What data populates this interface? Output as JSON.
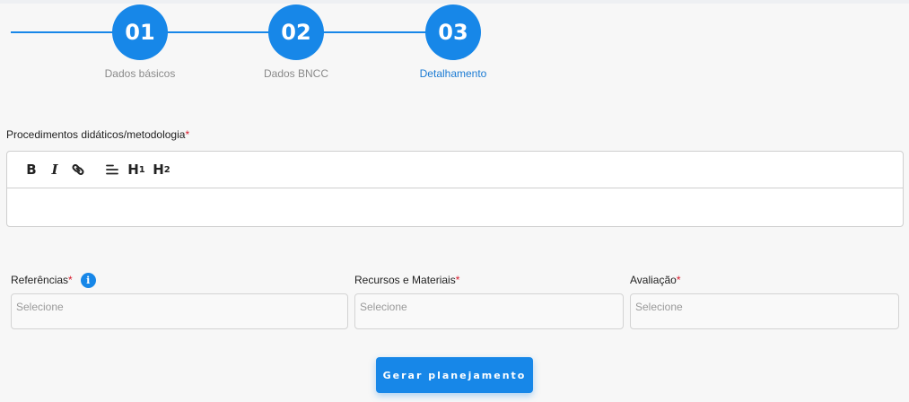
{
  "stepper": {
    "steps": [
      {
        "number": "01",
        "label": "Dados básicos"
      },
      {
        "number": "02",
        "label": "Dados BNCC"
      },
      {
        "number": "03",
        "label": "Detalhamento"
      }
    ]
  },
  "procedures": {
    "label": "Procedimentos didáticos/metodologia",
    "required_mark": "*",
    "toolbar": {
      "bold": "B",
      "italic": "I",
      "h1": "H",
      "h1_sub": "1",
      "h2": "H",
      "h2_sub": "2"
    },
    "icons": [
      "bold-icon",
      "italic-icon",
      "link-icon",
      "align-left-icon",
      "heading-1-icon",
      "heading-2-icon"
    ]
  },
  "fields": {
    "references": {
      "label": "Referências",
      "required_mark": "*",
      "placeholder": "Selecione",
      "info": "i"
    },
    "resources": {
      "label": "Recursos e Materiais",
      "required_mark": "*",
      "placeholder": "Selecione"
    },
    "evaluation": {
      "label": "Avaliação",
      "required_mark": "*",
      "placeholder": "Selecione"
    }
  },
  "submit": {
    "label": "Gerar planejamento"
  },
  "colors": {
    "accent": "#1787e8",
    "required": "#d8192b",
    "active_label": "#1b7bd3"
  }
}
